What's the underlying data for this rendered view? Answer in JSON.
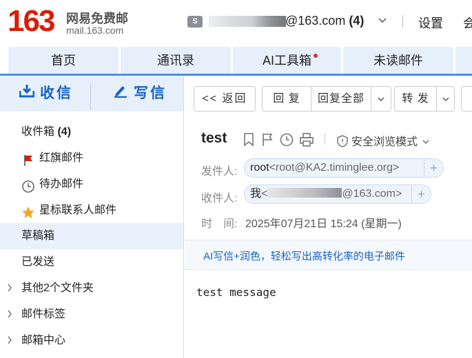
{
  "header": {
    "logo_number": "163",
    "logo_cn": "网易免费邮",
    "logo_url": "mail.163.com",
    "account_icon": "S",
    "account_suffix": "@163.com",
    "unread_count": "(4)",
    "settings": "设置",
    "more": "会"
  },
  "nav": {
    "tabs": [
      {
        "label": "首页"
      },
      {
        "label": "通讯录"
      },
      {
        "label": "AI工具箱"
      },
      {
        "label": "未读邮件"
      }
    ]
  },
  "sidebar": {
    "receive": "收信",
    "compose": "写信",
    "folders": [
      {
        "label": "收件箱",
        "count": "(4)"
      },
      {
        "label": "红旗邮件"
      },
      {
        "label": "待办邮件"
      },
      {
        "label": "星标联系人邮件"
      },
      {
        "label": "草稿箱"
      },
      {
        "label": "已发送"
      },
      {
        "label": "其他2个文件夹"
      },
      {
        "label": "邮件标签"
      },
      {
        "label": "邮箱中心"
      }
    ]
  },
  "toolbar": {
    "back": "<< 返回",
    "reply": "回 复",
    "reply_all": "回复全部",
    "forward": "转 发"
  },
  "mail": {
    "subject": "test",
    "safe_mode": "安全浏览模式",
    "from_label": "发件人:",
    "from_name": "root",
    "from_addr": "<root@KA2.timinglee.org>",
    "to_label": "收件人:",
    "to_name": "我",
    "to_addr_prefix": "<",
    "to_addr_suffix": "@163.com>",
    "time_label": "时　间:",
    "time_value": "2025年07月21日 15:24 (星期一)",
    "ai_banner": "AI写信+润色，轻松写出高转化率的电子邮件",
    "body": "test message"
  },
  "colors": {
    "brand_red": "#d81e06",
    "accent_blue": "#1a63c4",
    "tab_bg": "#e6f0fb",
    "active_row": "#e8f1fc"
  }
}
